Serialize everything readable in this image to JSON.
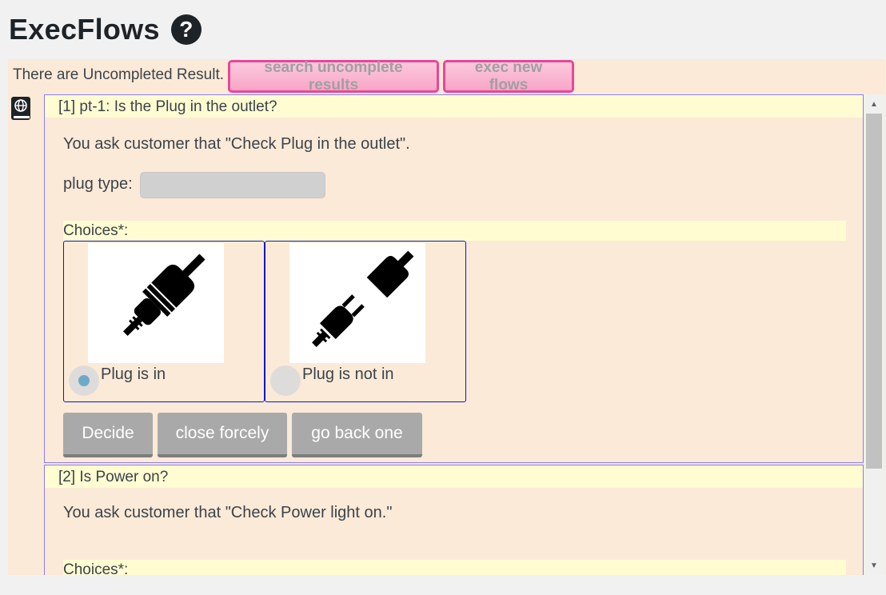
{
  "page": {
    "title": "ExecFlows",
    "help_icon": "question-circle-icon"
  },
  "toolbar": {
    "notice": "There are Uncompleted Result.",
    "search_label": "search uncomplete results",
    "exec_label": "exec new flows"
  },
  "steps": [
    {
      "header": "[1] pt-1: Is the Plug in the outlet?",
      "text": "You ask customer that \"Check Plug in the outlet\".",
      "plug_label": "plug type:",
      "plug_value": "",
      "choices_label": "Choices*:",
      "choices": [
        {
          "label": "Plug is in",
          "selected": true,
          "icon": "plug-connected-icon"
        },
        {
          "label": "Plug is not in",
          "selected": false,
          "icon": "plug-disconnected-icon"
        }
      ],
      "buttons": {
        "decide": "Decide",
        "close": "close forcely",
        "back": "go back one"
      }
    },
    {
      "header": "[2] Is Power on?",
      "text": "You ask customer that \"Check Power light on.\"",
      "choices_label": "Choices*:"
    }
  ],
  "colors": {
    "panel": "#fbead7",
    "header_band": "#fffcd2",
    "accent_pink": "#e8469b",
    "step_border": "#8a7df0",
    "choice_border": "#1414c8"
  }
}
